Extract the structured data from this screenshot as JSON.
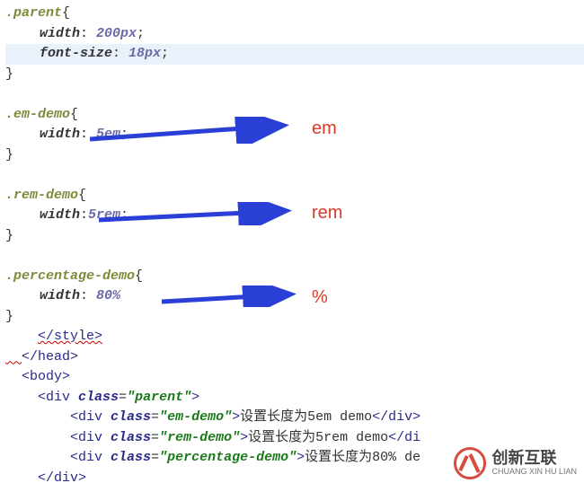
{
  "blocks": {
    "parent": {
      "selector": ".parent",
      "open": "{",
      "close": "}",
      "p1": {
        "prop": "width",
        "val": "200px",
        "semi": ";"
      },
      "p2": {
        "prop": "font-size",
        "val": "18px",
        "semi": ";"
      }
    },
    "em": {
      "selector": ".em-demo",
      "open": "{",
      "close": "}",
      "p1": {
        "prop": "width",
        "val": "5em",
        "semi": ";"
      }
    },
    "rem": {
      "selector": ".rem-demo",
      "open": "{",
      "close": "}",
      "p1": {
        "prop": "width",
        "val": "5rem",
        "semi": ";",
        "spacer": ":"
      }
    },
    "pct": {
      "selector": ".percentage-demo",
      "open": "{",
      "close": "}",
      "p1": {
        "prop": "width",
        "val": "80%",
        "semi": ""
      }
    }
  },
  "htmlpart": {
    "styleClose": "</style>",
    "headClose": "</head>",
    "bodyOpen": "<body>",
    "divOpen": {
      "open": "<div ",
      "attr": "class",
      "eq": "=",
      "val": "\"parent\"",
      "close": ">"
    },
    "row1": {
      "open": "<div ",
      "attr": "class",
      "eq": "=",
      "val": "\"em-demo\"",
      "close1": ">",
      "text": "设置长度为5em demo",
      "close2": "</div>"
    },
    "row2": {
      "open": "<div ",
      "attr": "class",
      "eq": "=",
      "val": "\"rem-demo\"",
      "close1": ">",
      "textPrefix": "设置长度为5rem demo",
      "close2": "</di"
    },
    "row3": {
      "open": "<div ",
      "attr": "class",
      "eq": "=",
      "val": "\"percentage-demo\"",
      "close1": ">",
      "text": "设置长度为80% de"
    },
    "divClose": "</div>"
  },
  "annotations": {
    "em": "em",
    "rem": "rem",
    "pct": "%"
  },
  "watermark": {
    "zh": "创新互联",
    "py": "CHUANG XIN HU LIAN"
  }
}
